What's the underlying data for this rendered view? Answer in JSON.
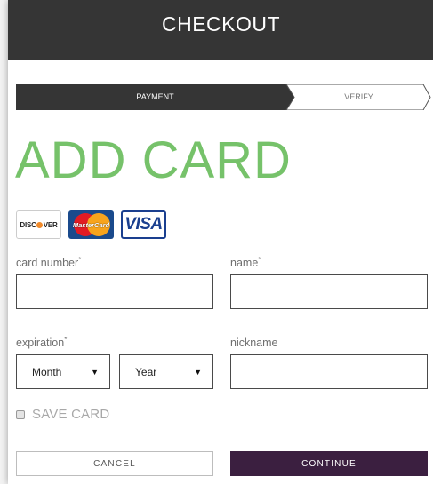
{
  "header": {
    "title": "CHECKOUT"
  },
  "steps": [
    {
      "label": "PAYMENT",
      "active": true
    },
    {
      "label": "VERIFY",
      "active": false
    }
  ],
  "heading": "ADD CARD",
  "card_logos": [
    {
      "name": "discover",
      "text_left": "DISC",
      "text_right": "VER"
    },
    {
      "name": "mastercard",
      "text": "MasterCard"
    },
    {
      "name": "visa",
      "text": "VISA"
    }
  ],
  "form": {
    "card_number": {
      "label": "card number",
      "required_mark": "*",
      "value": ""
    },
    "name": {
      "label": "name",
      "required_mark": "*",
      "value": ""
    },
    "expiration": {
      "label": "expiration",
      "required_mark": "*",
      "month": "Month",
      "year": "Year"
    },
    "nickname": {
      "label": "nickname",
      "value": ""
    },
    "save_card": {
      "label": "SAVE CARD",
      "checked": false
    }
  },
  "buttons": {
    "cancel": "CANCEL",
    "continue": "CONTINUE"
  },
  "colors": {
    "header_bg": "#353535",
    "accent_green": "#76c26a",
    "continue_bg": "#3b1f40",
    "step_active_bg": "#353535"
  },
  "icons": {
    "caret": "caret-down-icon",
    "checkbox": "checkbox-icon"
  }
}
